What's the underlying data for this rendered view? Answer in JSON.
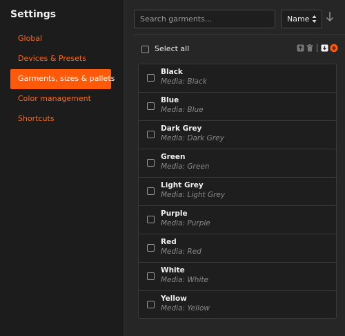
{
  "sidebar": {
    "title": "Settings",
    "items": [
      {
        "label": "Global"
      },
      {
        "label": "Devices & Presets"
      },
      {
        "label": "Garments, sizes & pallets",
        "active": true
      },
      {
        "label": "Color management"
      },
      {
        "label": "Shortcuts"
      }
    ]
  },
  "search": {
    "placeholder": "Search garments..."
  },
  "sort": {
    "label": "Name",
    "direction_icon": "arrow-down-icon"
  },
  "toolbar": {
    "select_all_label": "Select all",
    "icons": [
      "export-icon",
      "trash-icon",
      "import-icon",
      "add-icon"
    ]
  },
  "garments": [
    {
      "name": "Black",
      "media": "Media: Black"
    },
    {
      "name": "Blue",
      "media": "Media: Blue"
    },
    {
      "name": "Dark Grey",
      "media": "Media: Dark Grey"
    },
    {
      "name": "Green",
      "media": "Media: Green"
    },
    {
      "name": "Light Grey",
      "media": "Media: Light Grey"
    },
    {
      "name": "Purple",
      "media": "Media: Purple"
    },
    {
      "name": "Red",
      "media": "Media: Red"
    },
    {
      "name": "White",
      "media": "Media: White"
    },
    {
      "name": "Yellow",
      "media": "Media: Yellow"
    }
  ],
  "colors": {
    "accent": "#ff5a0a",
    "sidebar_bg": "#1c1c1c",
    "main_bg": "#262626"
  }
}
